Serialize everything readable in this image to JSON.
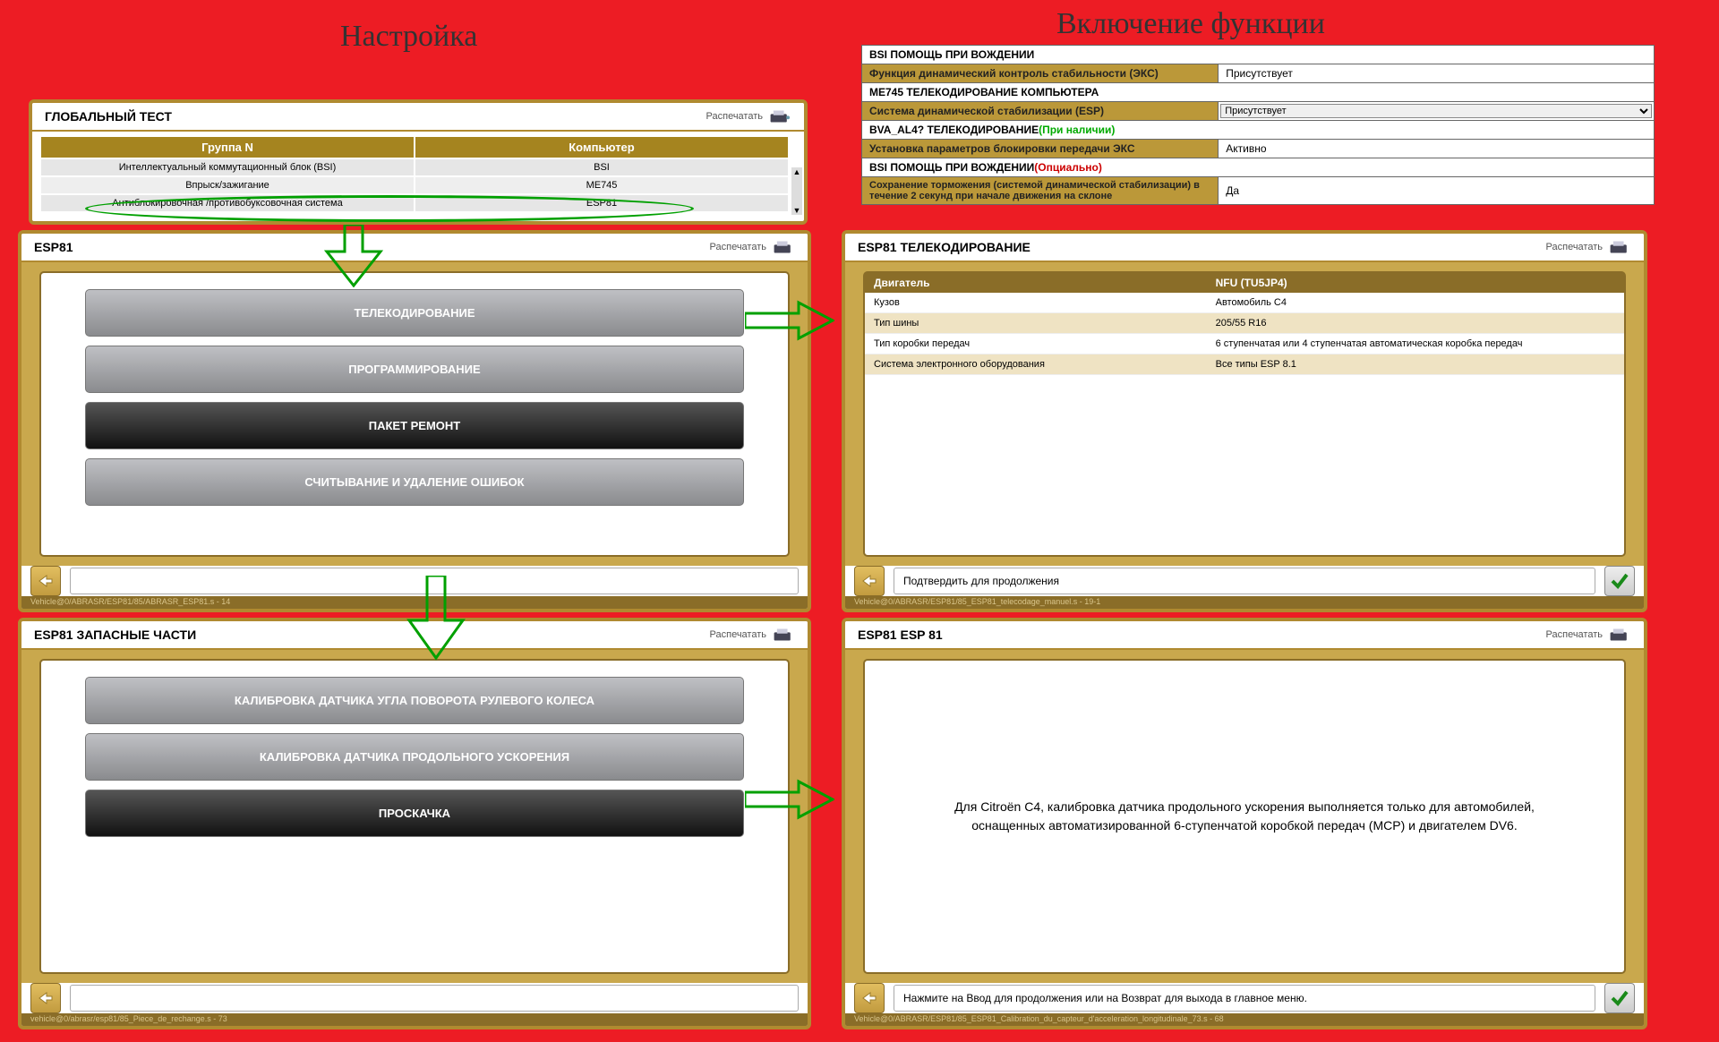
{
  "annotations": {
    "left_title": "Настройка",
    "right_title": "Включение функции"
  },
  "print_label": "Распечатать",
  "global_test": {
    "title": "ГЛОБАЛЬНЫЙ ТЕСТ",
    "col_group": "Группа N",
    "col_computer": "Компьютер",
    "rows": [
      {
        "g": "Интеллектуальный коммутационный блок (BSI)",
        "c": "BSI"
      },
      {
        "g": "Впрыск/зажигание",
        "c": "ME745"
      },
      {
        "g": "Антиблокировочная /противобуксовочная система",
        "c": "ESP81"
      }
    ]
  },
  "esp_menu": {
    "title": "ESP81",
    "btn1": "ТЕЛЕКОДИРОВАНИЕ",
    "btn2": "ПРОГРАММИРОВАНИЕ",
    "btn3": "ПАКЕТ РЕМОНТ",
    "btn4": "СЧИТЫВАНИЕ И УДАЛЕНИЕ ОШИБОК",
    "footer": "Vehicle@0/ABRASR/ESP81/85/ABRASR_ESP81.s - 14"
  },
  "spare": {
    "title": "ESP81  ЗАПАСНЫЕ ЧАСТИ",
    "btn1": "КАЛИБРОВКА ДАТЧИКА УГЛА ПОВОРОТА РУЛЕВОГО КОЛЕСА",
    "btn2": "КАЛИБРОВКА ДАТЧИКА ПРОДОЛЬНОГО УСКОРЕНИЯ",
    "btn3": "ПРОСКАЧКА",
    "footer": "vehicle@0/abrasr/esp81/85_Piece_de_rechange.s - 73"
  },
  "cfg": {
    "h1": "BSI  ПОМОЩЬ ПРИ ВОЖДЕНИИ",
    "r1l": "Функция динамический контроль стабильности (ЭКС)",
    "r1v": "Присутствует",
    "h2": "ME745  ТЕЛЕКОДИРОВАНИЕ КОМПЬЮТЕРА",
    "r2l": "Система динамической стабилизации (ESP)",
    "r2v": "Присутствует",
    "h3a": "BVA_AL4?  ТЕЛЕКОДИРОВАНИЕ",
    "h3b": "(При наличии)",
    "r3l": "Установка параметров блокировки передачи ЭКС",
    "r3v": "Активно",
    "h4a": "BSI  ПОМОЩЬ ПРИ ВОЖДЕНИИ",
    "h4b": "(Опциально)",
    "r4l": "Сохранение торможения (системой динамической стабилизации) в течение 2 секунд при начале движения на склоне",
    "r4v": "Да"
  },
  "tele": {
    "title": "ESP81  ТЕЛЕКОДИРОВАНИЕ",
    "col_param": "Двигатель",
    "col_val": "NFU (TU5JP4)",
    "rows": [
      {
        "p": "Кузов",
        "v": "Автомобиль C4"
      },
      {
        "p": "Тип шины",
        "v": "205/55 R16"
      },
      {
        "p": "Тип коробки передач",
        "v": "6 ступенчатая или 4 ступенчатая автоматическая коробка передач"
      },
      {
        "p": "Система электронного оборудования",
        "v": "Все типы ESP 8.1"
      }
    ],
    "confirm": "Подтвердить для продолжения",
    "footer": "Vehicle@0/ABRASR/ESP81/85_ESP81_telecodage_manuel.s - 19-1"
  },
  "esp81_info": {
    "title": "ESP81  ESP 81",
    "body": "Для Citroёn C4, калибровка датчика продольного ускорения выполняется только для автомобилей, оснащенных автоматизированной 6-ступенчатой коробкой передач (МСР) и двигателем DV6.",
    "hint": "Нажмите на Ввод для продолжения или на Возврат для выхода в главное меню.",
    "footer": "Vehicle@0/ABRASR/ESP81/85_ESP81_Calibration_du_capteur_d'acceleration_longitudinale_73.s - 68"
  }
}
